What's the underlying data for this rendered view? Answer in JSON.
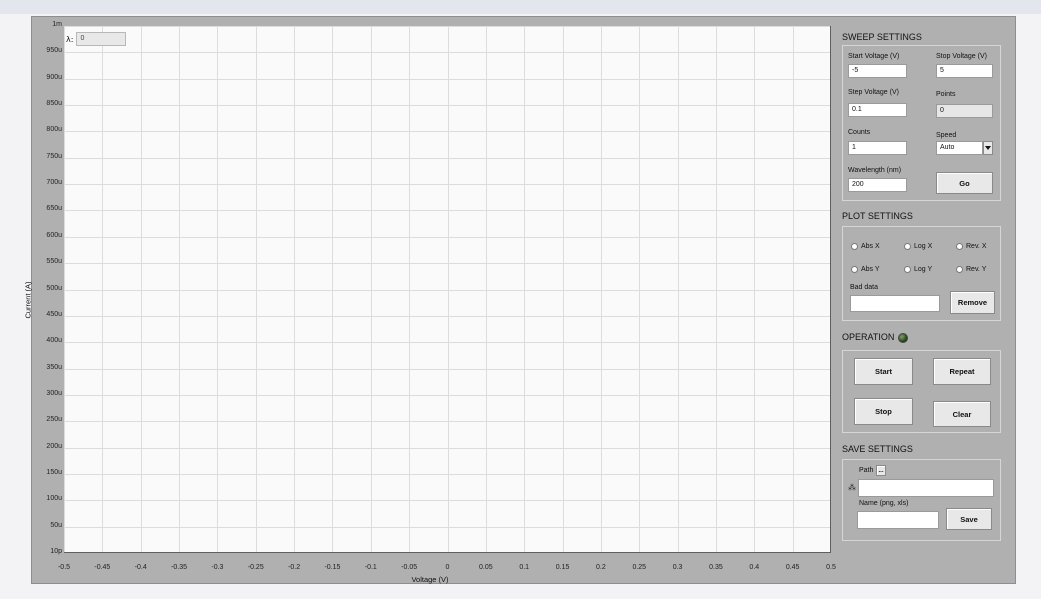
{
  "graph": {
    "cursor_symbol": "λ:",
    "cursor_value": "0",
    "y_label": "Current (A)",
    "x_label": "Voltage (V)",
    "y_ticks": [
      "1m",
      "950u",
      "900u",
      "850u",
      "800u",
      "750u",
      "700u",
      "650u",
      "600u",
      "550u",
      "500u",
      "450u",
      "400u",
      "350u",
      "300u",
      "250u",
      "200u",
      "150u",
      "100u",
      "50u",
      "10p"
    ],
    "x_ticks": [
      "-0.5",
      "-0.45",
      "-0.4",
      "-0.35",
      "-0.3",
      "-0.25",
      "-0.2",
      "-0.15",
      "-0.1",
      "-0.05",
      "0",
      "0.05",
      "0.1",
      "0.15",
      "0.2",
      "0.25",
      "0.3",
      "0.35",
      "0.4",
      "0.45",
      "0.5"
    ]
  },
  "sweep": {
    "title": "SWEEP SETTINGS",
    "start_label": "Start Voltage (V)",
    "start_value": "-5",
    "stop_label": "Stop Voltage (V)",
    "stop_value": "5",
    "step_label": "Step Voltage (V)",
    "step_value": "0.1",
    "points_label": "Points",
    "points_value": "0",
    "counts_label": "Counts",
    "counts_value": "1",
    "speed_label": "Speed",
    "speed_value": "Auto",
    "wavelength_label": "Wavelength (nm)",
    "wavelength_value": "200",
    "go_label": "Go"
  },
  "plot": {
    "title": "PLOT SETTINGS",
    "abs_x": "Abs X",
    "log_x": "Log X",
    "rev_x": "Rev.  X",
    "abs_y": "Abs Y",
    "log_y": "Log Y",
    "rev_y": "Rev.  Y",
    "bad_data_label": "Bad data",
    "bad_data_value": "",
    "remove_label": "Remove"
  },
  "operation": {
    "title": "OPERATION",
    "start_label": "Start",
    "repeat_label": "Repeat",
    "stop_label": "Stop",
    "clear_label": "Clear"
  },
  "save": {
    "title": "SAVE SETTINGS",
    "path_label": "Path",
    "browse_label": "...",
    "path_value": "",
    "name_label": "Name (png, xls)",
    "name_value": "",
    "save_label": "Save"
  },
  "colors": {
    "panel": "#b0b0b0",
    "plot_bg": "#fafafa",
    "led": "#2f5a1e"
  }
}
